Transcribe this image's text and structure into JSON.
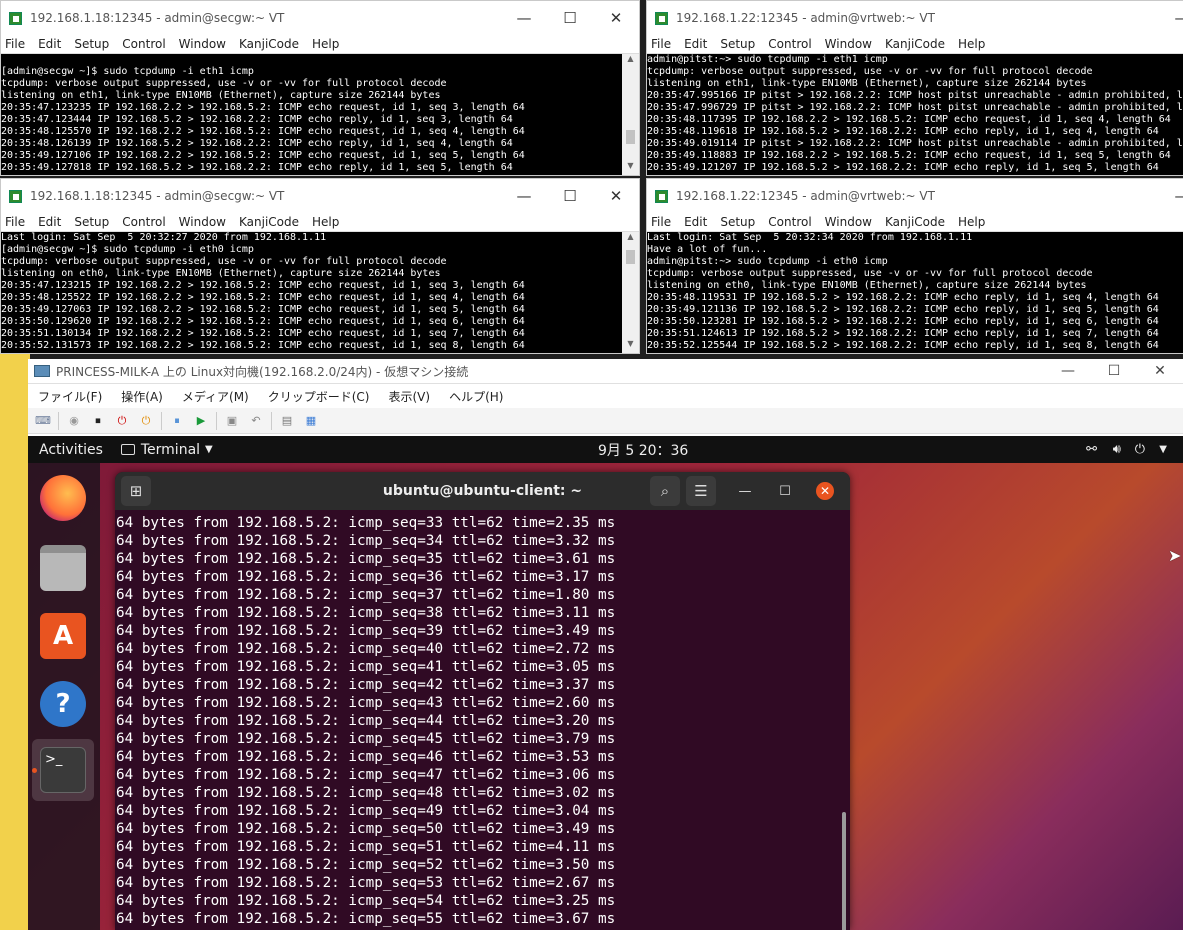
{
  "windows": [
    {
      "title": "192.168.1.18:12345 - admin@secgw:~ VT",
      "menu": [
        "File",
        "Edit",
        "Setup",
        "Control",
        "Window",
        "KanjiCode",
        "Help"
      ],
      "lines": [
        "[admin@secgw ~]$ sudo tcpdump -i eth1 icmp",
        "tcpdump: verbose output suppressed, use -v or -vv for full protocol decode",
        "listening on eth1, link-type EN10MB (Ethernet), capture size 262144 bytes",
        "20:35:47.123235 IP 192.168.2.2 > 192.168.5.2: ICMP echo request, id 1, seq 3, length 64",
        "20:35:47.123444 IP 192.168.5.2 > 192.168.2.2: ICMP echo reply, id 1, seq 3, length 64",
        "20:35:48.125570 IP 192.168.2.2 > 192.168.5.2: ICMP echo request, id 1, seq 4, length 64",
        "20:35:48.126139 IP 192.168.5.2 > 192.168.2.2: ICMP echo reply, id 1, seq 4, length 64",
        "20:35:49.127106 IP 192.168.2.2 > 192.168.5.2: ICMP echo request, id 1, seq 5, length 64",
        "20:35:49.127818 IP 192.168.5.2 > 192.168.2.2: ICMP echo reply, id 1, seq 5, length 64"
      ]
    },
    {
      "title": "192.168.1.22:12345 - admin@vrtweb:~ VT",
      "menu": [
        "File",
        "Edit",
        "Setup",
        "Control",
        "Window",
        "KanjiCode",
        "Help"
      ],
      "lines": [
        "admin@pitst:~> sudo tcpdump -i eth1 icmp",
        "tcpdump: verbose output suppressed, use -v or -vv for full protocol decode",
        "listening on eth1, link-type EN10MB (Ethernet), capture size 262144 bytes",
        "20:35:47.995166 IP pitst > 192.168.2.2: ICMP host pitst unreachable - admin prohibited, le",
        "20:35:47.996729 IP pitst > 192.168.2.2: ICMP host pitst unreachable - admin prohibited, le",
        "20:35:48.117395 IP 192.168.2.2 > 192.168.5.2: ICMP echo request, id 1, seq 4, length 64",
        "20:35:48.119618 IP 192.168.5.2 > 192.168.2.2: ICMP echo reply, id 1, seq 4, length 64",
        "20:35:49.019114 IP pitst > 192.168.2.2: ICMP host pitst unreachable - admin prohibited, le",
        "20:35:49.118883 IP 192.168.2.2 > 192.168.5.2: ICMP echo request, id 1, seq 5, length 64",
        "20:35:49.121207 IP 192.168.5.2 > 192.168.2.2: ICMP echo reply, id 1, seq 5, length 64"
      ]
    },
    {
      "title": "192.168.1.18:12345 - admin@secgw:~ VT",
      "menu": [
        "File",
        "Edit",
        "Setup",
        "Control",
        "Window",
        "KanjiCode",
        "Help"
      ],
      "lines": [
        "Last login: Sat Sep  5 20:32:27 2020 from 192.168.1.11",
        "[admin@secgw ~]$ sudo tcpdump -i eth0 icmp",
        "tcpdump: verbose output suppressed, use -v or -vv for full protocol decode",
        "listening on eth0, link-type EN10MB (Ethernet), capture size 262144 bytes",
        "20:35:47.123215 IP 192.168.2.2 > 192.168.5.2: ICMP echo request, id 1, seq 3, length 64",
        "20:35:48.125522 IP 192.168.2.2 > 192.168.5.2: ICMP echo request, id 1, seq 4, length 64",
        "20:35:49.127063 IP 192.168.2.2 > 192.168.5.2: ICMP echo request, id 1, seq 5, length 64",
        "20:35:50.129620 IP 192.168.2.2 > 192.168.5.2: ICMP echo request, id 1, seq 6, length 64",
        "20:35:51.130134 IP 192.168.2.2 > 192.168.5.2: ICMP echo request, id 1, seq 7, length 64",
        "20:35:52.131573 IP 192.168.2.2 > 192.168.5.2: ICMP echo request, id 1, seq 8, length 64"
      ]
    },
    {
      "title": "192.168.1.22:12345 - admin@vrtweb:~ VT",
      "menu": [
        "File",
        "Edit",
        "Setup",
        "Control",
        "Window",
        "KanjiCode",
        "Help"
      ],
      "lines": [
        "Last login: Sat Sep  5 20:32:34 2020 from 192.168.1.11",
        "Have a lot of fun...",
        "admin@pitst:~> sudo tcpdump -i eth0 icmp",
        "tcpdump: verbose output suppressed, use -v or -vv for full protocol decode",
        "listening on eth0, link-type EN10MB (Ethernet), capture size 262144 bytes",
        "20:35:48.119531 IP 192.168.5.2 > 192.168.2.2: ICMP echo reply, id 1, seq 4, length 64",
        "20:35:49.121136 IP 192.168.5.2 > 192.168.2.2: ICMP echo reply, id 1, seq 5, length 64",
        "20:35:50.123281 IP 192.168.5.2 > 192.168.2.2: ICMP echo reply, id 1, seq 6, length 64",
        "20:35:51.124613 IP 192.168.5.2 > 192.168.2.2: ICMP echo reply, id 1, seq 7, length 64",
        "20:35:52.125544 IP 192.168.5.2 > 192.168.2.2: ICMP echo reply, id 1, seq 8, length 64"
      ]
    }
  ],
  "vm": {
    "title": "PRINCESS-MILK-A 上の Linux対向機(192.168.2.0/24内) - 仮想マシン接続",
    "menu": [
      "ファイル(F)",
      "操作(A)",
      "メディア(M)",
      "クリップボード(C)",
      "表示(V)",
      "ヘルプ(H)"
    ]
  },
  "gnome": {
    "activities": "Activities",
    "app_menu": "Terminal",
    "clock": "9月 5 20：36"
  },
  "terminal": {
    "title": "ubuntu@ubuntu-client: ~",
    "lines": [
      "64 bytes from 192.168.5.2: icmp_seq=33 ttl=62 time=2.35 ms",
      "64 bytes from 192.168.5.2: icmp_seq=34 ttl=62 time=3.32 ms",
      "64 bytes from 192.168.5.2: icmp_seq=35 ttl=62 time=3.61 ms",
      "64 bytes from 192.168.5.2: icmp_seq=36 ttl=62 time=3.17 ms",
      "64 bytes from 192.168.5.2: icmp_seq=37 ttl=62 time=1.80 ms",
      "64 bytes from 192.168.5.2: icmp_seq=38 ttl=62 time=3.11 ms",
      "64 bytes from 192.168.5.2: icmp_seq=39 ttl=62 time=3.49 ms",
      "64 bytes from 192.168.5.2: icmp_seq=40 ttl=62 time=2.72 ms",
      "64 bytes from 192.168.5.2: icmp_seq=41 ttl=62 time=3.05 ms",
      "64 bytes from 192.168.5.2: icmp_seq=42 ttl=62 time=3.37 ms",
      "64 bytes from 192.168.5.2: icmp_seq=43 ttl=62 time=2.60 ms",
      "64 bytes from 192.168.5.2: icmp_seq=44 ttl=62 time=3.20 ms",
      "64 bytes from 192.168.5.2: icmp_seq=45 ttl=62 time=3.79 ms",
      "64 bytes from 192.168.5.2: icmp_seq=46 ttl=62 time=3.53 ms",
      "64 bytes from 192.168.5.2: icmp_seq=47 ttl=62 time=3.06 ms",
      "64 bytes from 192.168.5.2: icmp_seq=48 ttl=62 time=3.02 ms",
      "64 bytes from 192.168.5.2: icmp_seq=49 ttl=62 time=3.04 ms",
      "64 bytes from 192.168.5.2: icmp_seq=50 ttl=62 time=3.49 ms",
      "64 bytes from 192.168.5.2: icmp_seq=51 ttl=62 time=4.11 ms",
      "64 bytes from 192.168.5.2: icmp_seq=52 ttl=62 time=3.50 ms",
      "64 bytes from 192.168.5.2: icmp_seq=53 ttl=62 time=2.67 ms",
      "64 bytes from 192.168.5.2: icmp_seq=54 ttl=62 time=3.25 ms",
      "64 bytes from 192.168.5.2: icmp_seq=55 ttl=62 time=3.67 ms"
    ]
  },
  "colors": {
    "ubuntu_orange": "#e95420",
    "terminal_bg": "#300a24"
  }
}
